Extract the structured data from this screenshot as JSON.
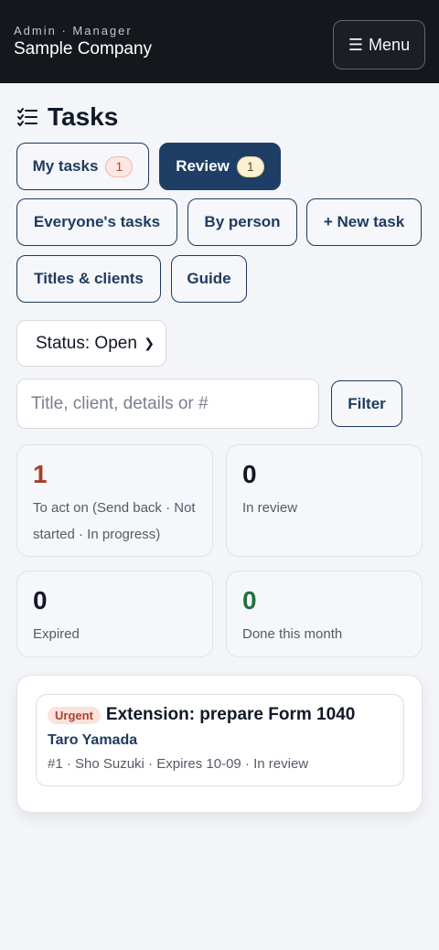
{
  "header": {
    "role": "Admin · Manager",
    "company": "Sample Company",
    "menu_label": "Menu"
  },
  "page": {
    "title": "Tasks"
  },
  "tabs": {
    "my_tasks": {
      "label": "My tasks",
      "count": "1"
    },
    "review": {
      "label": "Review",
      "count": "1"
    },
    "everyone": {
      "label": "Everyone's tasks"
    },
    "by_person": {
      "label": "By person"
    },
    "new_task": {
      "label": "+ New task"
    },
    "titles_clients": {
      "label": "Titles & clients"
    },
    "guide": {
      "label": "Guide"
    }
  },
  "filters": {
    "status_value": "Status: Open",
    "search_placeholder": "Title, client, details or #",
    "filter_label": "Filter"
  },
  "stats": [
    {
      "value": "1",
      "label": "To act on (Send back · Not started · In progress)",
      "color": "#a14129"
    },
    {
      "value": "0",
      "label": "In review",
      "color": "#111827"
    },
    {
      "value": "0",
      "label": "Expired",
      "color": "#111827"
    },
    {
      "value": "0",
      "label": "Done this month",
      "color": "#24703f"
    }
  ],
  "task_list": [
    {
      "priority": "Urgent",
      "title": "Extension: prepare Form 1040",
      "client": "Taro Yamada",
      "meta": "#1 · Sho Suzuki · Expires 10-09 · In review"
    }
  ],
  "colors": {
    "accent": "#1e3e66",
    "header_bg": "#14171c"
  }
}
